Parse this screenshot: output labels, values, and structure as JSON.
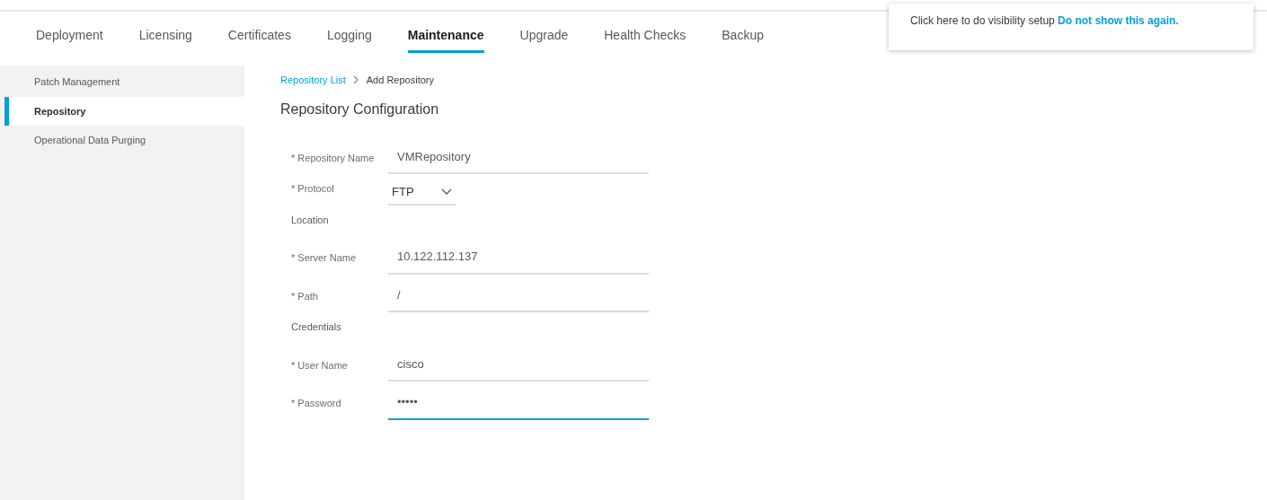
{
  "tabs": [
    {
      "label": "Deployment",
      "selected": false
    },
    {
      "label": "Licensing",
      "selected": false
    },
    {
      "label": "Certificates",
      "selected": false
    },
    {
      "label": "Logging",
      "selected": false
    },
    {
      "label": "Maintenance",
      "selected": true
    },
    {
      "label": "Upgrade",
      "selected": false
    },
    {
      "label": "Health Checks",
      "selected": false
    },
    {
      "label": "Backup",
      "selected": false
    }
  ],
  "notice": {
    "text": "Click here to do visibility setup",
    "link": "Do not show this again."
  },
  "sidebar": {
    "items": [
      {
        "label": "Patch Management",
        "selected": false
      },
      {
        "label": "Repository",
        "selected": true
      },
      {
        "label": "Operational Data Purging",
        "selected": false
      }
    ]
  },
  "breadcrumb": {
    "link": "Repository List",
    "current": "Add Repository"
  },
  "heading": "Repository Configuration",
  "form": [
    {
      "kind": "field",
      "label": "* Repository Name",
      "value": "VMRepository",
      "focused": false
    },
    {
      "kind": "select",
      "label": "* Protocol",
      "value": "FTP"
    },
    {
      "kind": "section",
      "label": "Location"
    },
    {
      "kind": "field",
      "label": "* Server Name",
      "value": "10.122.112.137",
      "focused": false
    },
    {
      "kind": "field",
      "label": "* Path",
      "value": "/",
      "focused": false
    },
    {
      "kind": "section",
      "label": "Credentials"
    },
    {
      "kind": "field",
      "label": "* User Name",
      "value": "cisco",
      "focused": false
    },
    {
      "kind": "field",
      "label": "* Password",
      "value": "•••••",
      "focused": true
    }
  ]
}
